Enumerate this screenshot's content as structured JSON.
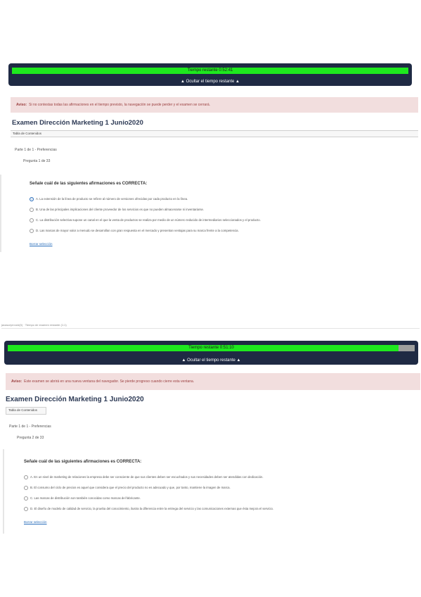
{
  "shot1": {
    "timer": {
      "text": "Tiempo restante 0:52:41",
      "toggle": "▲ Ocultar el tiempo restante ▲",
      "remaining_fraction": 1.0
    },
    "notice": {
      "label": "Aviso:",
      "text": "Si no contestas todas las afirmaciones en el tiempo previsto, la navegación se puede perder y el examen se cerrará."
    },
    "exam_title": "Examen Dirección Marketing 1  Junio2020",
    "toc_button": "Tabla de Contenidos",
    "part_label": "Parte 1 de 1 - Preferencias",
    "question_count": "Pregunta 1 de 33",
    "question": {
      "stem": "Señale cuál de las siguientes afirmaciones es CORRECTA:",
      "options": [
        {
          "text": "A. La extensión de la línea de producto se refiere al número de versiones ofrecidas por cada producto en la línea.",
          "checked": true
        },
        {
          "text": "B. Una de las principales implicaciones del cliente proveedor de los servicios es que no pueden almacenarse ni inventariarse.",
          "checked": false
        },
        {
          "text": "C. La distribución selectiva supone un canal en el que la venta de productos se realiza por medio de un número reducido de intermediarios seleccionados y el producto.",
          "checked": false
        },
        {
          "text": "D. Las marcas de mayor valor a menudo se desarrollan con gran respuesta en el mercado y presentan ventajas para su marca frente a la competencia.",
          "checked": false
        }
      ],
      "clear": "Borrar selección"
    }
  },
  "between_text": "javascript:void(0) · Tiempo de examen restante (1:1)",
  "shot2": {
    "timer": {
      "text": "Tiempo restante 0:51:10",
      "toggle": "▲ Ocultar el tiempo restante ▲",
      "remaining_fraction": 0.96
    },
    "notice": {
      "label": "Aviso:",
      "text": "Este examen se abrirá en una nueva ventana del navegador. Se pierde progreso cuando cierre esta ventana."
    },
    "exam_title": "Examen Dirección Marketing 1  Junio2020",
    "toc_button": "Tabla de Contenidos",
    "part_label": "Parte 1 de 1 - Preferencias",
    "question_count": "Pregunta 2 de 33",
    "question": {
      "stem": "Señale cuál de las siguientes afirmaciones es CORRECTA:",
      "options": [
        {
          "text": "A. En un nivel de marketing de relaciones la empresa debe ser consciente de que sus clientes deben ser escuchados y sus necesidades deben ser atendidas con dedicación.",
          "checked": false
        },
        {
          "text": "B. El consumo del ciclo de precios es aquel que considera que el precio del producto no es adecuado y que, por tanto, mantiene la imagen de marca.",
          "checked": false
        },
        {
          "text": "C. Las marcas de distribución son también conocidas como marcas del fabricante.",
          "checked": false
        },
        {
          "text": "D. El diseño de modelo de calidad de servicio, la prueba del conocimiento, ilustra la diferencia entre la entrega del servicio y las comunicaciones externas que ésta mejora el servicio.",
          "checked": false
        }
      ],
      "clear": "Borrar selección"
    }
  }
}
